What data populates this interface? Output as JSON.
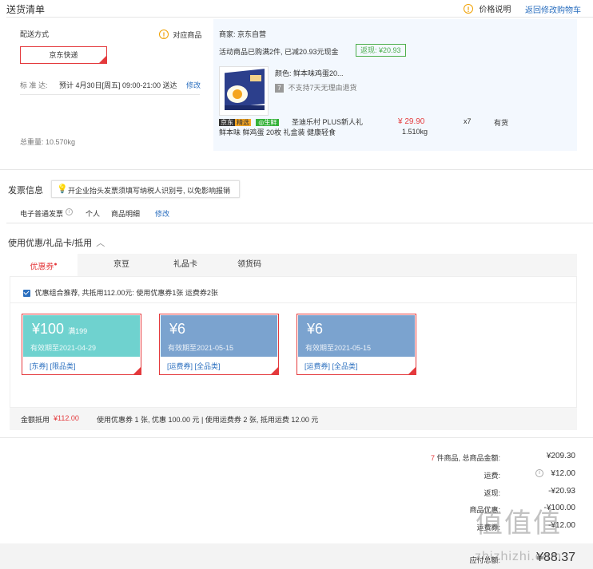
{
  "header": {
    "title": "送货清单",
    "price_note": "价格说明",
    "back_to_cart": "返回修改购物车"
  },
  "delivery": {
    "label": "配送方式",
    "supported_goods": "对应商品",
    "method": "京东快递",
    "standard_label": "标 准 达:",
    "standard_time": "预计 4月30日[周五] 09:00-21:00 送达",
    "edit": "修改",
    "total_weight": "总重量: 10.570kg"
  },
  "merchant": {
    "label": "商家: 京东自营",
    "promo": "活动商品已购满2件, 已减20.93元现金",
    "return_badge": "返现: ¥20.93",
    "item": {
      "color": "颜色: 鲜本味鸡蛋20...",
      "no_return": "不支持7天无理由退货",
      "tag_jd": "京东",
      "tag_jx": "精选",
      "tag_fresh": "生鲜",
      "title_line1": "圣迪乐村 PLUS新人礼",
      "title_line2": "鲜本味 鲜鸡蛋 20枚 礼盒装 健康轻食",
      "price": "¥ 29.90",
      "weight": "1.510kg",
      "qty": "x7",
      "stock": "有货"
    }
  },
  "invoice": {
    "title": "发票信息",
    "tip": "开企业抬头发票须填写纳税人识别号, 以免影响报销",
    "type": "电子普通发票",
    "holder": "个人",
    "content": "商品明细",
    "edit": "修改"
  },
  "discount": {
    "title": "使用优惠/礼品卡/抵用",
    "tabs": [
      "优惠券",
      "京豆",
      "礼品卡",
      "领货码"
    ],
    "recommend": "优惠组合推荐, 共抵用112.00元: 使用优惠券1张 运费券2张",
    "coupons": [
      {
        "amount": "¥100",
        "cond": "满199",
        "expire": "有效期至2021-04-29",
        "tags": "[东券]  [限品类]",
        "color": "#6fd2cf"
      },
      {
        "amount": "¥6",
        "cond": "",
        "expire": "有效期至2021-05-15",
        "tags": "[运费券]  [全品类]",
        "color": "#7ba3cf"
      },
      {
        "amount": "¥6",
        "cond": "",
        "expire": "有效期至2021-05-15",
        "tags": "[运费券]  [全品类]",
        "color": "#7ba3cf"
      }
    ],
    "summary_label": "金额抵用",
    "summary_amount": "¥112.00",
    "summary_detail": "使用优惠券 1 张, 优惠 100.00 元  | 使用运费券 2 张, 抵用运费 12.00 元"
  },
  "totals": {
    "count": "7",
    "count_label": "件商品, 总商品金额:",
    "goods_amount": "¥209.30",
    "shipping_label": "运费:",
    "shipping_amount": "¥12.00",
    "cashback_label": "返现:",
    "cashback_amount": "-¥20.93",
    "coupon_label": "商品优惠:",
    "coupon_amount": "-¥100.00",
    "ship_coupon_label": "运费券:",
    "ship_coupon_amount": "-¥12.00",
    "payable_label": "应付总额:",
    "payable_amount": "¥88.37"
  },
  "watermark": {
    "logo": "值值值",
    "url": "zhizhizhi.com"
  },
  "colors": {
    "accent_red": "#e4393c",
    "link_blue": "#2b6fbf",
    "green": "#4cae4c",
    "panel_blue": "#f3f8fe"
  }
}
